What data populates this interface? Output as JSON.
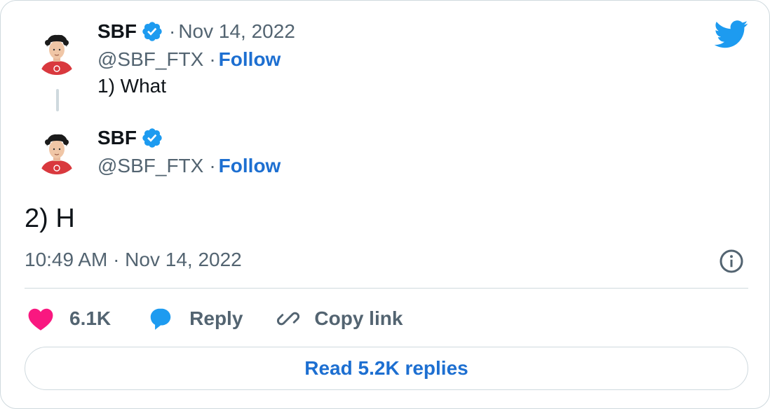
{
  "colors": {
    "twitter_blue": "#1d9bf0",
    "link_blue": "#1d6fd1",
    "text_primary": "#0f1419",
    "text_secondary": "#536471",
    "like_pink": "#f91880",
    "border": "#cfd9de"
  },
  "quoted_tweet": {
    "name": "SBF",
    "separator": "·",
    "date": "Nov 14, 2022",
    "handle": "@SBF_FTX",
    "handle_separator": "·",
    "follow_label": "Follow",
    "text": "1) What"
  },
  "main_tweet": {
    "name": "SBF",
    "handle": "@SBF_FTX",
    "handle_separator": "·",
    "follow_label": "Follow",
    "text": "2) H",
    "timestamp": "10:49 AM · Nov 14, 2022"
  },
  "actions": {
    "like_count": "6.1K",
    "reply_label": "Reply",
    "copy_link_label": "Copy link"
  },
  "read_replies_label": "Read 5.2K replies",
  "icons": [
    "twitter-bird-icon",
    "verified-badge-icon",
    "info-icon",
    "heart-icon",
    "reply-bubble-icon",
    "link-icon"
  ]
}
